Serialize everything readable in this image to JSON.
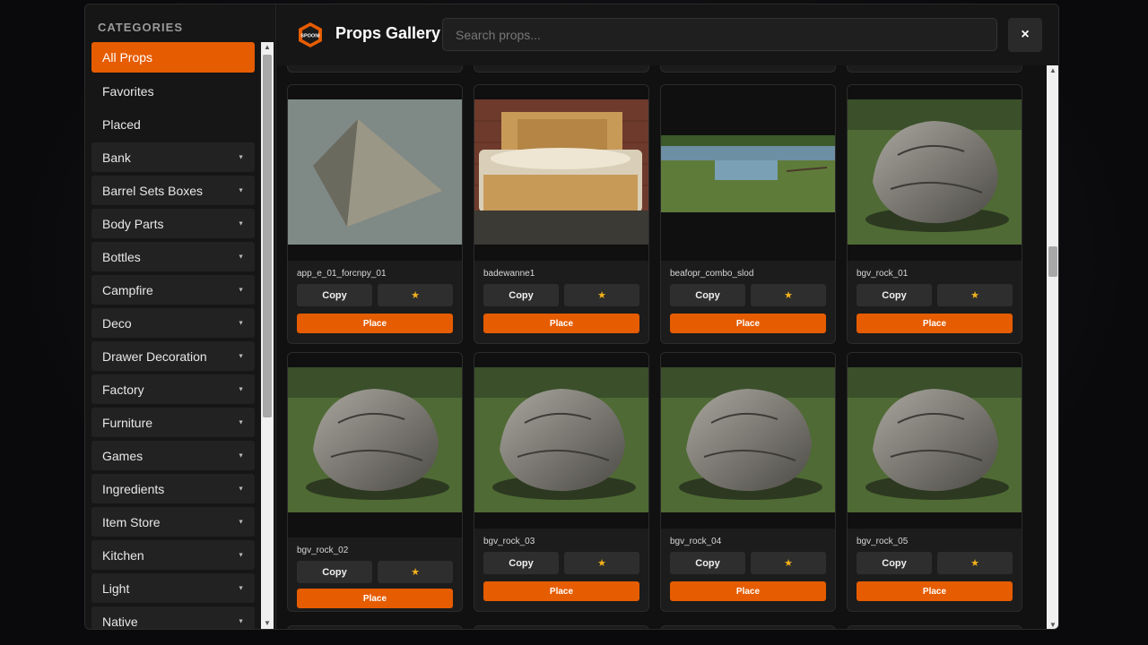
{
  "app": {
    "title": "Props Gallery",
    "logo_text": "SPOONI"
  },
  "search": {
    "placeholder": "Search props..."
  },
  "close": {
    "label": "×"
  },
  "sidebar": {
    "heading": "CATEGORIES",
    "items": [
      {
        "label": "All Props",
        "active": true,
        "expandable": false
      },
      {
        "label": "Favorites",
        "active": false,
        "expandable": false
      },
      {
        "label": "Placed",
        "active": false,
        "expandable": false
      },
      {
        "label": "Bank",
        "active": false,
        "expandable": true
      },
      {
        "label": "Barrel Sets Boxes",
        "active": false,
        "expandable": true
      },
      {
        "label": "Body Parts",
        "active": false,
        "expandable": true
      },
      {
        "label": "Bottles",
        "active": false,
        "expandable": true
      },
      {
        "label": "Campfire",
        "active": false,
        "expandable": true
      },
      {
        "label": "Deco",
        "active": false,
        "expandable": true
      },
      {
        "label": "Drawer Decoration",
        "active": false,
        "expandable": true
      },
      {
        "label": "Factory",
        "active": false,
        "expandable": true
      },
      {
        "label": "Furniture",
        "active": false,
        "expandable": true
      },
      {
        "label": "Games",
        "active": false,
        "expandable": true
      },
      {
        "label": "Ingredients",
        "active": false,
        "expandable": true
      },
      {
        "label": "Item Store",
        "active": false,
        "expandable": true
      },
      {
        "label": "Kitchen",
        "active": false,
        "expandable": true
      },
      {
        "label": "Light",
        "active": false,
        "expandable": true
      },
      {
        "label": "Native",
        "active": false,
        "expandable": true
      }
    ]
  },
  "props": [
    {
      "name": "app_e_01_forcnpy_01",
      "preview": "canopy"
    },
    {
      "name": "badewanne1",
      "preview": "bathtub"
    },
    {
      "name": "beafopr_combo_slod",
      "preview": "landscape"
    },
    {
      "name": "bgv_rock_01",
      "preview": "rock"
    },
    {
      "name": "bgv_rock_02",
      "preview": "rock"
    },
    {
      "name": "bgv_rock_03",
      "preview": "rock"
    },
    {
      "name": "bgv_rock_04",
      "preview": "rock"
    },
    {
      "name": "bgv_rock_05",
      "preview": "rock"
    }
  ],
  "card_actions": {
    "copy": "Copy",
    "favorite": "★",
    "place": "Place"
  },
  "colors": {
    "accent": "#e65c00",
    "star": "#f3b21b",
    "panel": "#161616"
  }
}
